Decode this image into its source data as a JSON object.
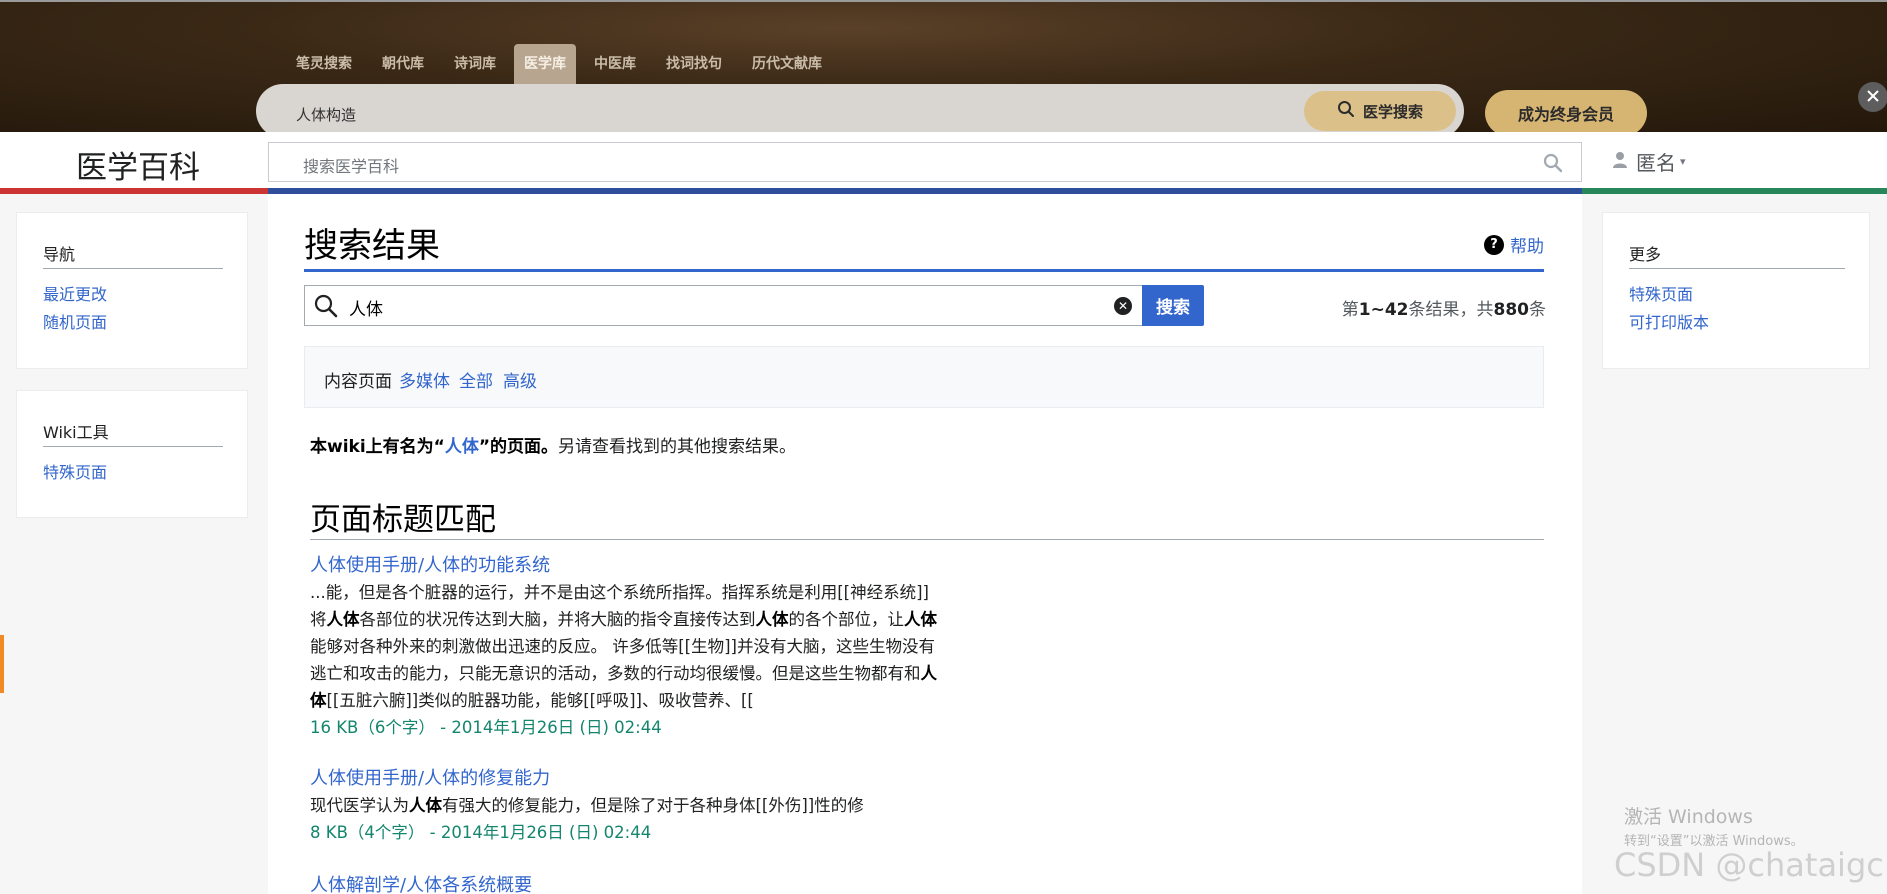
{
  "top_nav": {
    "tabs": [
      {
        "label": "笔灵搜索",
        "active": false
      },
      {
        "label": "朝代库",
        "active": false
      },
      {
        "label": "诗词库",
        "active": false
      },
      {
        "label": "医学库",
        "active": true
      },
      {
        "label": "中医库",
        "active": false
      },
      {
        "label": "找词找句",
        "active": false
      },
      {
        "label": "历代文献库",
        "active": false
      }
    ],
    "search_value": "人体构造",
    "search_button": "医学搜索",
    "member_button": "成为终身会员"
  },
  "wiki_header": {
    "site_title": "医学百科",
    "search_placeholder": "搜索医学百科",
    "user_label": "匿名"
  },
  "sidebar_left": {
    "nav_heading": "导航",
    "nav_links": [
      "最近更改",
      "随机页面"
    ],
    "tools_heading": "Wiki工具",
    "tools_links": [
      "特殊页面"
    ]
  },
  "sidebar_right": {
    "heading": "更多",
    "links": [
      "特殊页面",
      "可打印版本"
    ]
  },
  "main": {
    "heading": "搜索结果",
    "help": "帮助",
    "search_value": "人体",
    "search_button": "搜索",
    "count_prefix": "第",
    "count_range": "1~42",
    "count_mid": "条结果，共",
    "count_total": "880",
    "count_suffix": "条",
    "filters": [
      "内容页面",
      "多媒体",
      "全部",
      "高级"
    ],
    "exact_match": {
      "prefix": "本wiki上有名为“",
      "term": "人体",
      "suffix": "”的页面。",
      "rest": "另请查看找到的其他搜索结果。"
    },
    "section_heading": "页面标题匹配",
    "results": [
      {
        "title": "人体使用手册/人体的功能系统",
        "lines": [
          [
            {
              "t": "...能，但是各个脏器的运行，并不是由这个系统所指挥。指挥系统是利用[[神经系统]]",
              "b": false
            }
          ],
          [
            {
              "t": "将",
              "b": false
            },
            {
              "t": "人体",
              "b": true
            },
            {
              "t": "各部位的状况传达到大脑，并将大脑的指令直接传达到",
              "b": false
            },
            {
              "t": "人体",
              "b": true
            },
            {
              "t": "的各个部位，让",
              "b": false
            },
            {
              "t": "人体",
              "b": true
            }
          ],
          [
            {
              "t": "能够对各种外来的刺激做出迅速的反应。 许多低等[[生物]]并没有大脑，这些生物没有",
              "b": false
            }
          ],
          [
            {
              "t": "逃亡和攻击的能力，只能无意识的活动，多数的行动均很缓慢。但是这些生物都有和",
              "b": false
            },
            {
              "t": "人",
              "b": true
            }
          ],
          [
            {
              "t": "体",
              "b": true
            },
            {
              "t": "[[五脏六腑]]类似的脏器功能，能够[[呼吸]]、吸收营养、[[",
              "b": false
            }
          ]
        ],
        "meta": "16 KB（6个字） - 2014年1月26日 (日) 02:44"
      },
      {
        "title": "人体使用手册/人体的修复能力",
        "lines": [
          [
            {
              "t": "现代医学认为",
              "b": false
            },
            {
              "t": "人体",
              "b": true
            },
            {
              "t": "有强大的修复能力，但是除了对于各种身体[[外伤]]性的修",
              "b": false
            }
          ]
        ],
        "meta": "8 KB（4个字） - 2014年1月26日 (日) 02:44"
      },
      {
        "title": "人体解剖学/人体各系统概要",
        "lines": [],
        "meta": ""
      }
    ]
  },
  "watermark": {
    "line1": "激活 Windows",
    "line2": "转到“设置”以激活 Windows。",
    "line3": "CSDN @chataigc"
  },
  "colors": {
    "link": "#3366cc",
    "meta_green": "#14866d",
    "stripe_red": "#cc3333",
    "stripe_blue": "#2e4d9a",
    "stripe_green": "#28875a",
    "gold_button": "#d6b472"
  }
}
